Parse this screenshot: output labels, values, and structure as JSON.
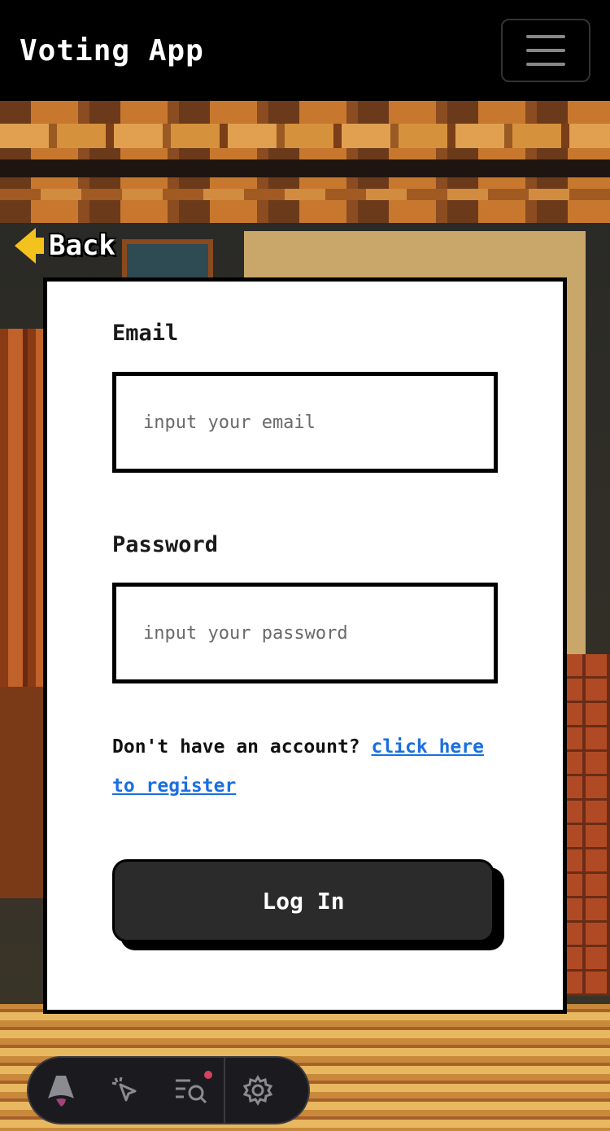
{
  "header": {
    "title": "Voting App",
    "menu_icon": "hamburger-icon"
  },
  "back_link": {
    "label": "Back",
    "icon": "arrow-left-icon"
  },
  "form": {
    "email_label": "Email",
    "email_placeholder": "input your email",
    "password_label": "Password",
    "password_placeholder": "input your password",
    "account_prompt": "Don't have an account?",
    "register_link": "click here to register",
    "submit_label": "Log In"
  },
  "colors": {
    "link": "#1a6fe0",
    "button_bg": "#2b2b2b",
    "back_arrow": "#f4c21c"
  },
  "dev_toolbar": {
    "icons": [
      "astro-logo-icon",
      "pointer-inspect-icon",
      "audit-search-icon",
      "gear-icon"
    ]
  }
}
